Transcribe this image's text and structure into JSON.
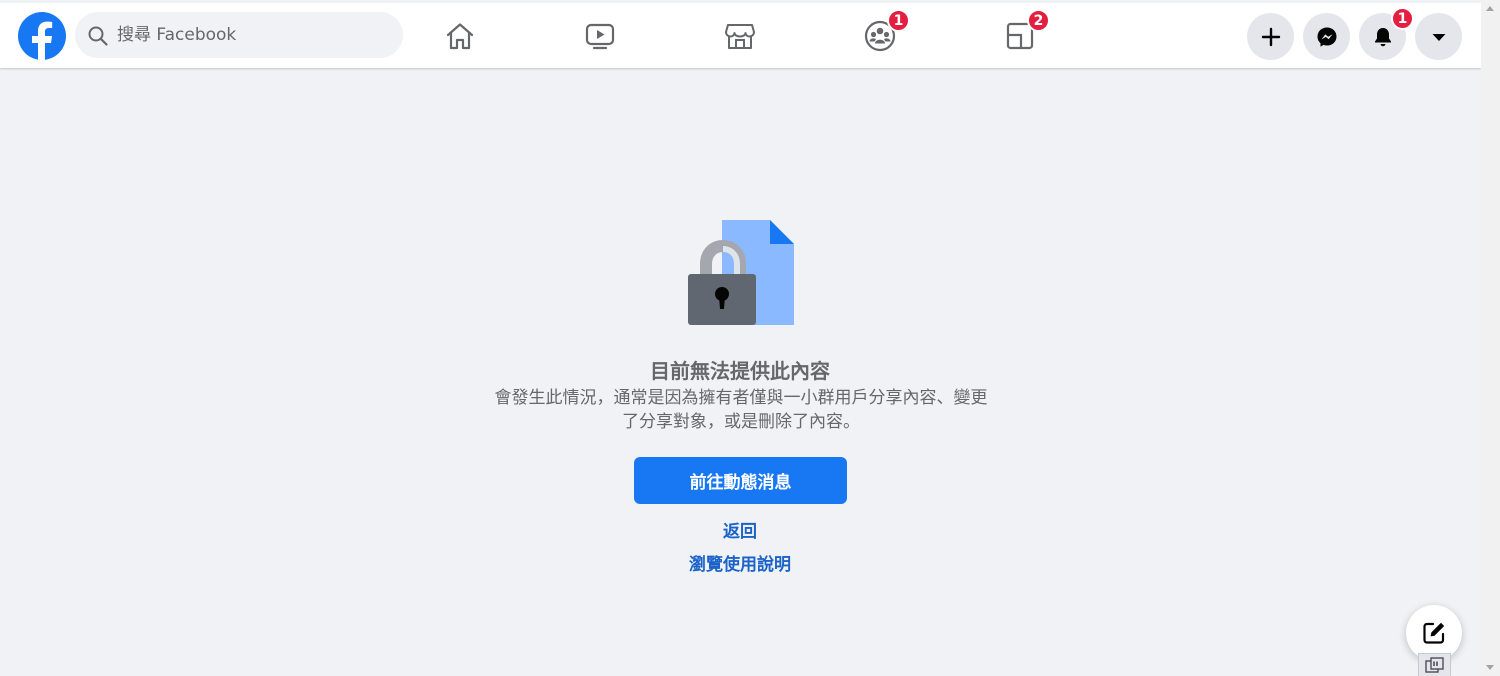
{
  "header": {
    "search": {
      "placeholder": "搜尋 Facebook"
    },
    "nav_tabs": [
      {
        "name": "home",
        "icon": "home-icon",
        "badge": ""
      },
      {
        "name": "watch",
        "icon": "video-icon",
        "badge": ""
      },
      {
        "name": "marketplace",
        "icon": "store-icon",
        "badge": ""
      },
      {
        "name": "groups",
        "icon": "groups-icon",
        "badge": "1"
      },
      {
        "name": "gaming",
        "icon": "gaming-icon",
        "badge": "2"
      }
    ],
    "actions": {
      "create": {
        "icon": "plus-icon"
      },
      "messenger": {
        "icon": "messenger-icon"
      },
      "notifications": {
        "icon": "bell-icon",
        "badge": "1"
      },
      "account": {
        "icon": "caret-down-icon"
      }
    }
  },
  "content": {
    "title": "目前無法提供此內容",
    "description": "會發生此情況，通常是因為擁有者僅與一小群用戶分享內容、變更了分享對象，或是刪除了內容。",
    "primary_button": "前往動態消息",
    "links": {
      "back": "返回",
      "help": "瀏覽使用說明"
    }
  },
  "colors": {
    "brand": "#1877f2",
    "badge": "#e41e3f",
    "background": "#f0f2f5",
    "link": "#1b63c9"
  }
}
